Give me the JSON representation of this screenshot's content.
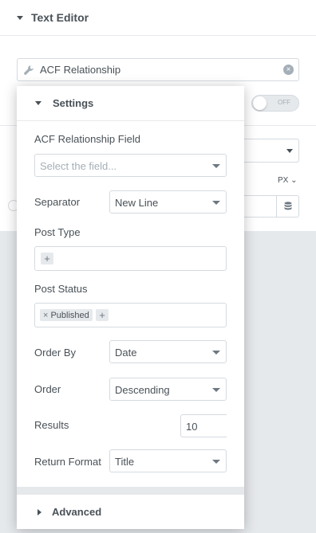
{
  "panel": {
    "section_title": "Text Editor",
    "dynamic_tag_label": "ACF Relationship",
    "toggle_text": "OFF",
    "unit_label": "PX ⌄"
  },
  "popover": {
    "settings_title": "Settings",
    "relationship_field": {
      "label": "ACF Relationship Field",
      "placeholder": "Select the field..."
    },
    "separator": {
      "label": "Separator",
      "value": "New Line"
    },
    "post_type": {
      "label": "Post Type"
    },
    "post_status": {
      "label": "Post Status",
      "chips": [
        "Published"
      ]
    },
    "order_by": {
      "label": "Order By",
      "value": "Date"
    },
    "order": {
      "label": "Order",
      "value": "Descending"
    },
    "results": {
      "label": "Results",
      "value": "10"
    },
    "return_format": {
      "label": "Return Format",
      "value": "Title"
    },
    "advanced_title": "Advanced"
  }
}
